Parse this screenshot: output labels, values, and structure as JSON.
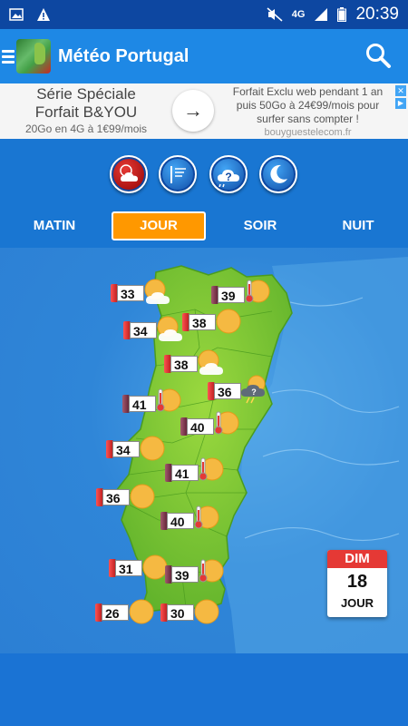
{
  "status": {
    "time": "20:39",
    "network": "4G"
  },
  "app": {
    "title": "Météo Portugal"
  },
  "ad": {
    "left_line1": "Série Spéciale",
    "left_line2": "Forfait B&YOU",
    "left_line3": "20Go en 4G à 1€99/mois",
    "right_line1": "Forfait Exclu web pendant 1 an",
    "right_line2": "puis 50Go à 24€99/mois pour",
    "right_line3": "surfer sans compter !",
    "right_url": "bouyguestelecom.fr"
  },
  "modes": [
    {
      "name": "weather-mode",
      "icon": "sun-cloud-icon",
      "active": true
    },
    {
      "name": "wind-mode",
      "icon": "wind-icon",
      "active": false
    },
    {
      "name": "forecast-mode",
      "icon": "cloud-question-icon",
      "active": false
    },
    {
      "name": "night-mode",
      "icon": "moon-icon",
      "active": false
    }
  ],
  "tabs": [
    {
      "label": "MATIN",
      "active": false
    },
    {
      "label": "JOUR",
      "active": true
    },
    {
      "label": "SOIR",
      "active": false
    },
    {
      "label": "NUIT",
      "active": false
    }
  ],
  "markers": [
    {
      "temp": "33",
      "icon": "sun-cloud",
      "flag": "red"
    },
    {
      "temp": "39",
      "icon": "thermometer",
      "flag": "dark"
    },
    {
      "temp": "34",
      "icon": "sun-cloud",
      "flag": "red"
    },
    {
      "temp": "38",
      "icon": "sun",
      "flag": "red"
    },
    {
      "temp": "38",
      "icon": "sun-cloud",
      "flag": "red"
    },
    {
      "temp": "36",
      "icon": "storm",
      "flag": "red"
    },
    {
      "temp": "41",
      "icon": "thermometer",
      "flag": "dark"
    },
    {
      "temp": "40",
      "icon": "thermometer",
      "flag": "dark"
    },
    {
      "temp": "34",
      "icon": "sun",
      "flag": "red"
    },
    {
      "temp": "41",
      "icon": "thermometer",
      "flag": "dark"
    },
    {
      "temp": "36",
      "icon": "sun",
      "flag": "red"
    },
    {
      "temp": "40",
      "icon": "thermometer",
      "flag": "dark"
    },
    {
      "temp": "31",
      "icon": "sun",
      "flag": "red"
    },
    {
      "temp": "39",
      "icon": "thermometer",
      "flag": "dark"
    },
    {
      "temp": "26",
      "icon": "sun",
      "flag": "red"
    },
    {
      "temp": "30",
      "icon": "sun",
      "flag": "red"
    }
  ],
  "date": {
    "dow": "DIM",
    "day": "18",
    "period": "JOUR"
  },
  "colors": {
    "accent": "#ff9800",
    "appbar": "#1e88e5",
    "land": "#7cc832"
  }
}
